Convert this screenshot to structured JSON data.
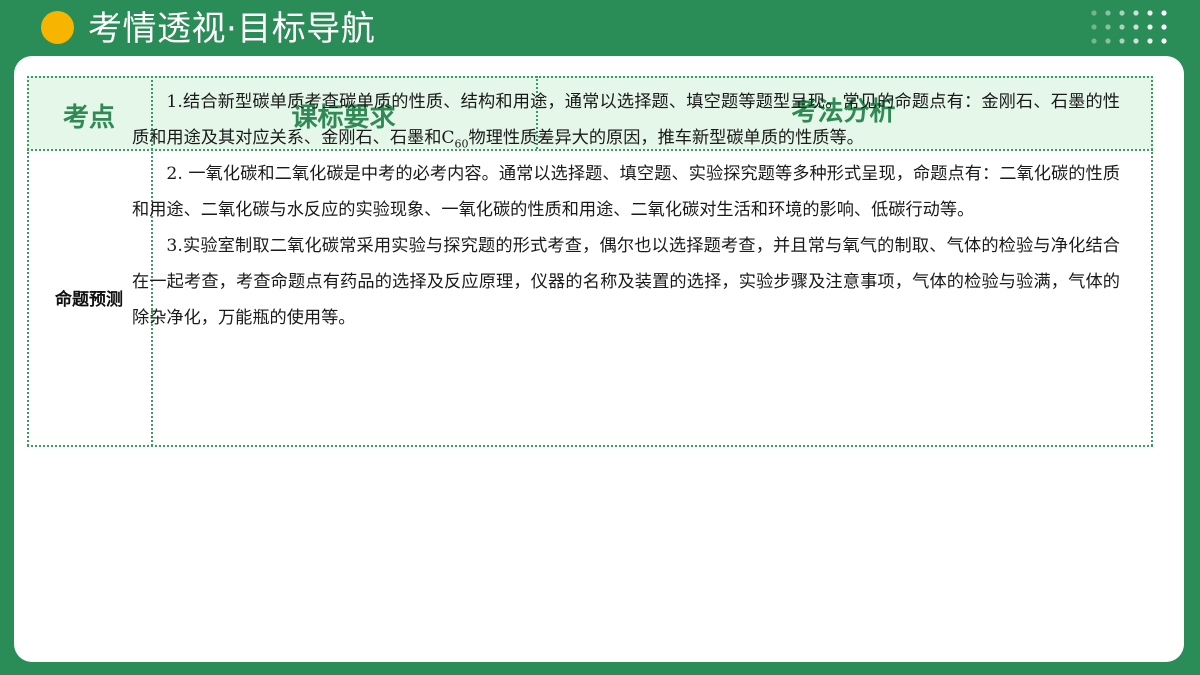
{
  "header": {
    "title": "考情透视·目标导航"
  },
  "table": {
    "headers": [
      "考点",
      "课标要求",
      "考法分析"
    ],
    "row_label": "命题预测",
    "p1_before": "1.结合新型碳单质考查碳单质的性质、结构和用途，通常以选择题、填空题等题型呈现。常见的命题点有：金刚石、石墨的性质和用途及其对应关系、金刚石、石墨和C",
    "p1_sub": "60",
    "p1_after": "物理性质差异大的原因，推车新型碳单质的性质等。",
    "p2": "2. 一氧化碳和二氧化碳是中考的必考内容。通常以选择题、填空题、实验探究题等多种形式呈现，命题点有：二氧化碳的性质和用途、二氧化碳与水反应的实验现象、一氧化碳的性质和用途、二氧化碳对生活和环境的影响、低碳行动等。",
    "p3": "3.实验室制取二氧化碳常采用实验与探究题的形式考查，偶尔也以选择题考查，并且常与氧气的制取、气体的检验与净化结合在一起考查，考查命题点有药品的选择及反应原理，仪器的名称及装置的选择，实验步骤及注意事项，气体的检验与验满，气体的除杂净化，万能瓶的使用等。"
  },
  "colors": {
    "background": "#2a8c57",
    "accent_dot": "#f7b500",
    "header_fill": "#e4f7e8",
    "header_text": "#2f8a55"
  }
}
